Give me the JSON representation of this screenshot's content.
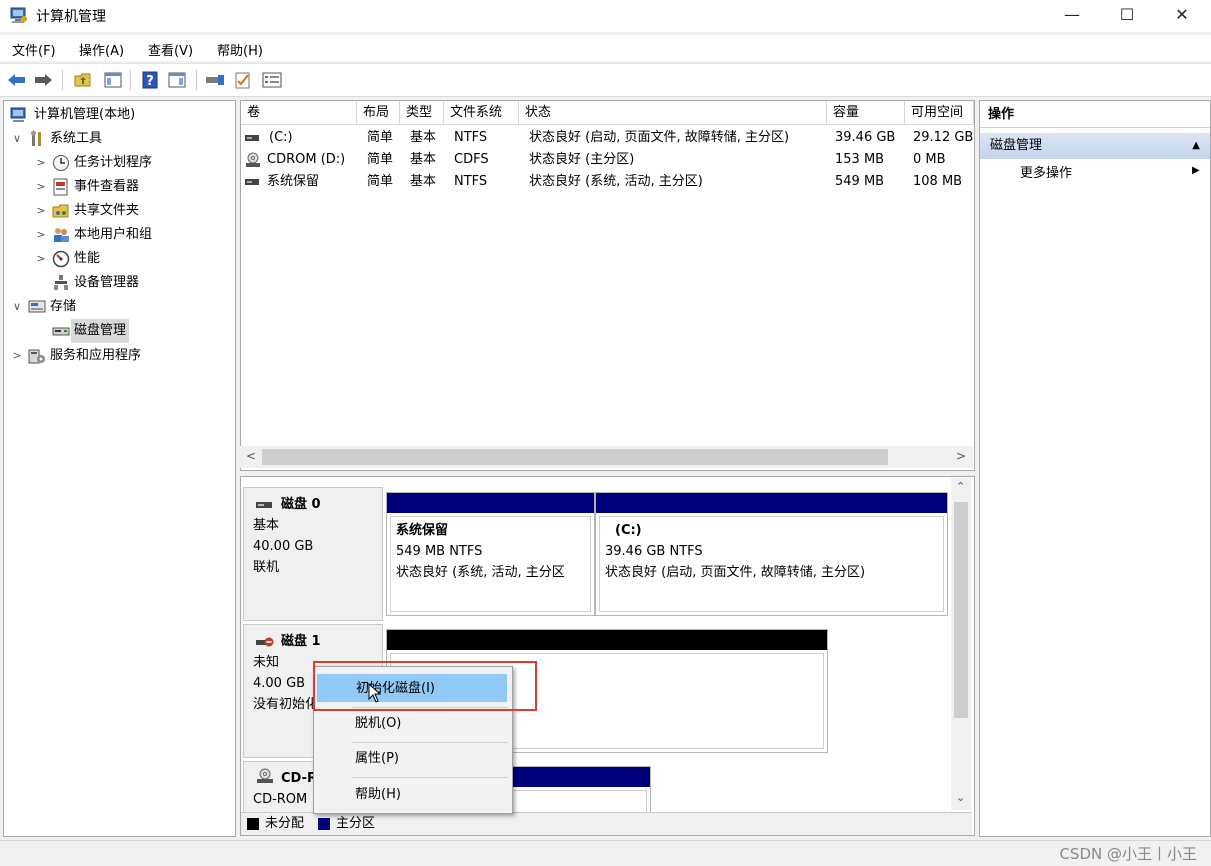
{
  "window": {
    "title": "计算机管理",
    "min_glyph": "—",
    "max_glyph": "☐",
    "close_glyph": "✕"
  },
  "menu": [
    "文件(F)",
    "操作(A)",
    "查看(V)",
    "帮助(H)"
  ],
  "toolbar": {
    "back": "back-arrow-icon",
    "forward": "forward-arrow-icon",
    "help_glyph": "?"
  },
  "tree": [
    {
      "label": "计算机管理(本地)",
      "icon": "computer-management-icon",
      "expander": ""
    },
    {
      "label": "系统工具",
      "icon": "tools-icon",
      "expander": "∨"
    },
    {
      "label": "任务计划程序",
      "icon": "clock-icon",
      "expander": ">"
    },
    {
      "label": "事件查看器",
      "icon": "event-viewer-icon",
      "expander": ">"
    },
    {
      "label": "共享文件夹",
      "icon": "shared-folder-icon",
      "expander": ">"
    },
    {
      "label": "本地用户和组",
      "icon": "users-icon",
      "expander": ">"
    },
    {
      "label": "性能",
      "icon": "performance-icon",
      "expander": ">"
    },
    {
      "label": "设备管理器",
      "icon": "device-manager-icon",
      "expander": ""
    },
    {
      "label": "存储",
      "icon": "storage-icon",
      "expander": "∨"
    },
    {
      "label": "磁盘管理",
      "icon": "disk-management-icon",
      "expander": ""
    },
    {
      "label": "服务和应用程序",
      "icon": "services-icon",
      "expander": ">"
    }
  ],
  "volumes": {
    "columns": [
      "卷",
      "布局",
      "类型",
      "文件系统",
      "状态",
      "容量",
      "可用空间"
    ],
    "rows": [
      [
        "(C:)",
        "简单",
        "基本",
        "NTFS",
        "状态良好 (启动, 页面文件, 故障转储, 主分区)",
        "39.46 GB",
        "29.12 GB"
      ],
      [
        "CDROM (D:)",
        "简单",
        "基本",
        "CDFS",
        "状态良好 (主分区)",
        "153 MB",
        "0 MB"
      ],
      [
        "系统保留",
        "简单",
        "基本",
        "NTFS",
        "状态良好 (系统, 活动, 主分区)",
        "549 MB",
        "108 MB"
      ]
    ]
  },
  "disks": {
    "disk0": {
      "name": "磁盘 0",
      "type": "基本",
      "size": "40.00 GB",
      "status": "联机",
      "partitions": [
        {
          "name": "系统保留",
          "size": "549 MB NTFS",
          "status": "状态良好 (系统, 活动, 主分区"
        },
        {
          "name": "(C:)",
          "size": "39.46 GB NTFS",
          "status": "状态良好 (启动, 页面文件, 故障转储, 主分区)"
        }
      ]
    },
    "disk1": {
      "name": "磁盘 1",
      "type": "未知",
      "size": "4.00 GB",
      "status": "没有初始化"
    },
    "cd": {
      "name": "CD-ROM 0",
      "type": "CD-ROM"
    }
  },
  "legend": {
    "unallocated": "未分配",
    "primary": "主分区"
  },
  "actions": {
    "header": "操作",
    "section": "磁盘管理",
    "more": "更多操作"
  },
  "context_menu": [
    "初始化磁盘(I)",
    "脱机(O)",
    "属性(P)",
    "帮助(H)"
  ],
  "watermark": "CSDN @小王丨小王",
  "colors": {
    "primary_partition": "#00007c",
    "unallocated": "#000000",
    "menu_hot": "#91c9f7",
    "highlight_box": "#e0392f"
  }
}
